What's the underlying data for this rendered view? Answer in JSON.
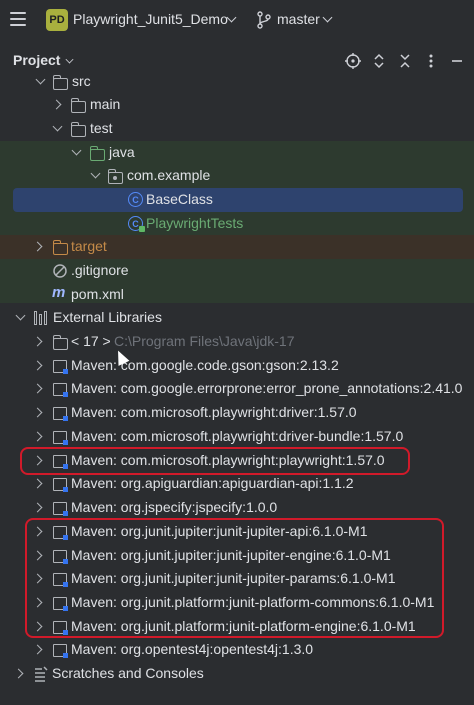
{
  "titlebar": {
    "project_badge": "PD",
    "project_name": "Playwright_Junit5_Demo",
    "branch": "master"
  },
  "panel": {
    "title": "Project"
  },
  "tree": {
    "src": "src",
    "main": "main",
    "test": "test",
    "java": "java",
    "package": "com.example",
    "base_class": "BaseClass",
    "playwright_tests": "PlaywrightTests",
    "target": "target",
    "gitignore": ".gitignore",
    "pom": "pom.xml",
    "external_libraries": "External Libraries",
    "jdk": "< 17 >",
    "jdk_path": "C:\\Program Files\\Java\\jdk-17",
    "libraries": [
      "Maven: com.google.code.gson:gson:2.13.2",
      "Maven: com.google.errorprone:error_prone_annotations:2.41.0",
      "Maven: com.microsoft.playwright:driver:1.57.0",
      "Maven: com.microsoft.playwright:driver-bundle:1.57.0",
      "Maven: com.microsoft.playwright:playwright:1.57.0",
      "Maven: org.apiguardian:apiguardian-api:1.1.2",
      "Maven: org.jspecify:jspecify:1.0.0",
      "Maven: org.junit.jupiter:junit-jupiter-api:6.1.0-M1",
      "Maven: org.junit.jupiter:junit-jupiter-engine:6.1.0-M1",
      "Maven: org.junit.jupiter:junit-jupiter-params:6.1.0-M1",
      "Maven: org.junit.platform:junit-platform-commons:6.1.0-M1",
      "Maven: org.junit.platform:junit-platform-engine:6.1.0-M1",
      "Maven: org.opentest4j:opentest4j:1.3.0"
    ],
    "scratches": "Scratches and Consoles"
  },
  "colors": {
    "background": "#2b2d30",
    "selection": "#2e436e",
    "test_band": "#2d3a2f",
    "target_band": "#3b3128",
    "annotation": "#d11a2a",
    "test_class_text": "#6aab73",
    "target_text": "#c48a48",
    "pom_text": "#a0b8ff"
  }
}
